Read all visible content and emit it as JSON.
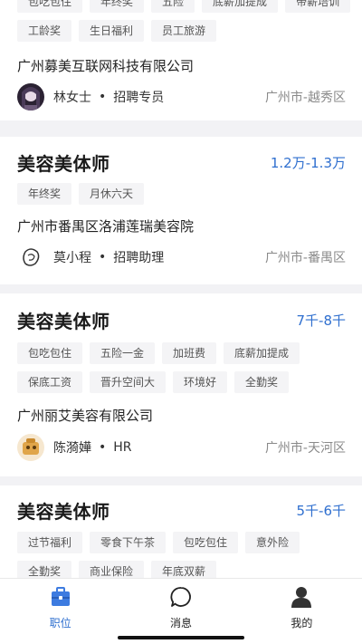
{
  "cards": [
    {
      "tags_row1": [
        "包吃包住",
        "年终奖",
        "五险",
        "底薪加提成"
      ],
      "tags_row2": [
        "带薪培训",
        "工龄奖",
        "生日福利",
        "员工旅游"
      ],
      "company": "广州募美互联网科技有限公司",
      "recruiter": {
        "name": "林女士",
        "role": "招聘专员"
      },
      "location": "广州市-越秀区"
    },
    {
      "title": "美容美体师",
      "salary": "1.2万-1.3万",
      "tags": [
        "年终奖",
        "月休六天"
      ],
      "company": "广州市番禺区洛浦莲瑞美容院",
      "recruiter": {
        "name": "莫小程",
        "role": "招聘助理"
      },
      "location": "广州市-番禺区"
    },
    {
      "title": "美容美体师",
      "salary": "7千-8千",
      "tags": [
        "包吃包住",
        "五险一金",
        "加班费",
        "底薪加提成",
        "保底工资",
        "晋升空间大",
        "环境好",
        "全勤奖"
      ],
      "company": "广州丽艾美容有限公司",
      "recruiter": {
        "name": "陈漪嬅",
        "role": "HR"
      },
      "location": "广州市-天河区"
    },
    {
      "title": "美容美体师",
      "salary": "5千-6千",
      "tags": [
        "过节福利",
        "零食下午茶",
        "包吃包住",
        "意外险",
        "全勤奖",
        "商业保险",
        "年底双薪"
      ]
    }
  ],
  "separator": "•",
  "tabbar": {
    "items": [
      {
        "label": "职位",
        "icon": "briefcase-icon",
        "active": true
      },
      {
        "label": "消息",
        "icon": "chat-bubble-icon",
        "active": false
      },
      {
        "label": "我的",
        "icon": "person-icon",
        "active": false
      }
    ]
  },
  "colors": {
    "accent": "#2f6fcf",
    "background": "#f2f2f5",
    "tag_bg": "#f4f4f6"
  }
}
